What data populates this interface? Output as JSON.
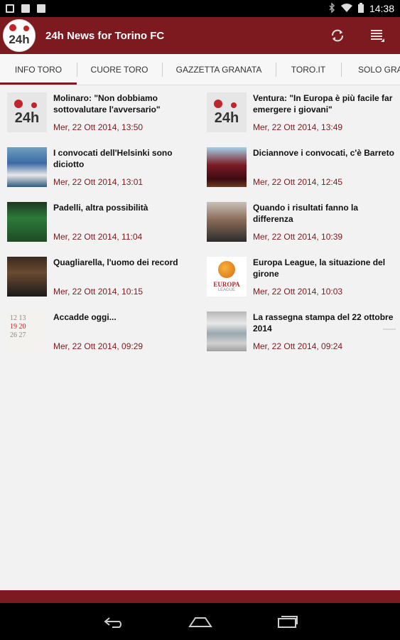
{
  "statusbar": {
    "time": "14:38"
  },
  "appbar": {
    "title": "24h News for Torino FC",
    "logo_text": "24h"
  },
  "tabs": [
    {
      "label": "INFO TORO",
      "active": true
    },
    {
      "label": "CUORE TORO",
      "active": false
    },
    {
      "label": "GAZZETTA GRANATA",
      "active": false
    },
    {
      "label": "TORO.IT",
      "active": false
    },
    {
      "label": "SOLO GRAN",
      "active": false
    }
  ],
  "news_left": [
    {
      "title": "Molinaro: \"Non dobbiamo sottovalutare l'avversario\"",
      "date": "Mer, 22 Ott 2014, 13:50",
      "thumb": "24h-logo"
    },
    {
      "title": "I convocati dell'Helsinki sono diciotto",
      "date": "Mer, 22 Ott 2014, 13:01",
      "thumb": "team-photo"
    },
    {
      "title": "Padelli, altra possibilità",
      "date": "Mer, 22 Ott 2014, 11:04",
      "thumb": "goalkeeper-photo"
    },
    {
      "title": "Quagliarella, l'uomo dei record",
      "date": "Mer, 22 Ott 2014, 10:15",
      "thumb": "player-photo"
    },
    {
      "title": "Accadde oggi...",
      "date": "Mer, 22 Ott 2014, 09:29",
      "thumb": "calendar-photo"
    }
  ],
  "news_right": [
    {
      "title": "Ventura: \"In Europa è più facile far emergere i giovani\"",
      "date": "Mer, 22 Ott 2014, 13:49",
      "thumb": "24h-logo"
    },
    {
      "title": "Diciannove i convocati, c'è Barreto",
      "date": "Mer, 22 Ott 2014, 12:45",
      "thumb": "player-photo"
    },
    {
      "title": "Quando i risultati fanno la differenza",
      "date": "Mer, 22 Ott 2014, 10:39",
      "thumb": "coach-photo"
    },
    {
      "title": "Europa League, la situazione del girone",
      "date": "Mer, 22 Ott 2014, 10:03",
      "thumb": "europa-league-logo"
    },
    {
      "title": "La rassegna stampa del 22 ottobre 2014",
      "date": "Mer, 22 Ott 2014, 09:24",
      "thumb": "newspapers-photo"
    }
  ],
  "thumbs_text": {
    "europa_1": "EUROPA",
    "europa_2": "LEAGUE",
    "calendar_l1": "12 13",
    "calendar_l2": "19 20",
    "calendar_l3": "26 27"
  },
  "colors": {
    "brand": "#7c1a1f",
    "accent_date": "#7c1a1f"
  }
}
